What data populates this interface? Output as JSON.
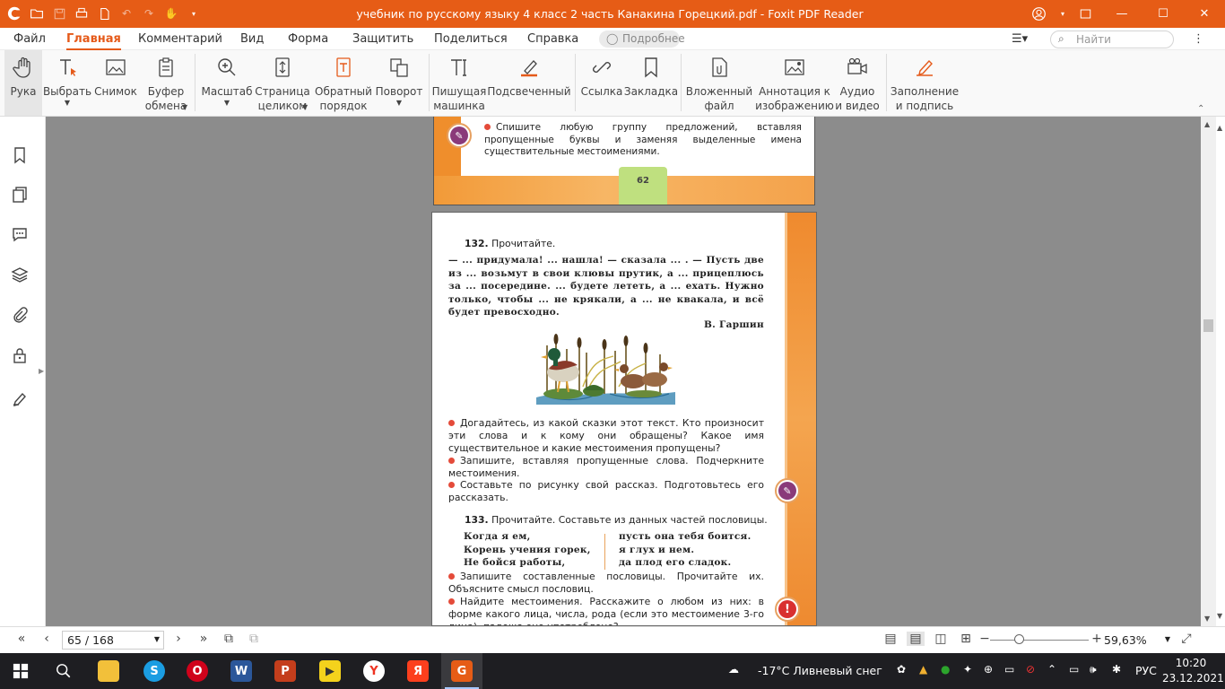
{
  "window": {
    "title": "учебник по русскому языку 4 класс 2 часть Канакина Горецкий.pdf - Foxit PDF Reader"
  },
  "menu": {
    "tabs": [
      "Файл",
      "Главная",
      "Комментарий",
      "Вид",
      "Форма",
      "Защитить",
      "Поделиться",
      "Справка"
    ],
    "active_tab": "Главная",
    "tell_me": "Подробнее",
    "search_placeholder": "Найти"
  },
  "ribbon": {
    "hand": "Рука",
    "select": "Выбрать",
    "snapshot": "Снимок",
    "clipboard_1": "Буфер",
    "clipboard_2": "обмена",
    "zoom": "Масштаб",
    "fit_1": "Страница",
    "fit_2": "целиком",
    "reverse_1": "Обратный",
    "reverse_2": "порядок",
    "rotate": "Поворот",
    "typewriter_1": "Пишущая",
    "typewriter_2": "машинка",
    "highlight": "Подсвеченный",
    "link": "Ссылка",
    "bookmark": "Закладка",
    "attach_1": "Вложенный",
    "attach_2": "файл",
    "imgannot_1": "Аннотация к",
    "imgannot_2": "изображению",
    "media_1": "Аудио",
    "media_2": "и видео",
    "fillsign_1": "Заполнение",
    "fillsign_2": "и подпись"
  },
  "doc": {
    "prev_task": "Спишите любую группу предложений, вставляя пропущенные буквы и заменяя выделенные имена существительные местоимениями.",
    "prev_page_number": "62",
    "ex132_num": "132.",
    "ex132_title": "Прочитайте.",
    "ex132_text": "— ... придумала! ... нашла! — сказала ... . — Пусть две из ... возьмут в свои клювы прутик, а ... прицеплюсь за ... посередине. ... будете лететь, а ... ехать. Нужно только, чтобы ... не крякали, а ... не квакала, и всё будет превосходно.",
    "ex132_author": "В. Гаршин",
    "task1": "Догадайтесь, из какой сказки этот текст. Кто произносит эти слова и к кому они обращены? Какое имя существительное и какие местоимения пропущены?",
    "task2": "Запишите, вставляя пропущенные слова. Подчеркните местоимения.",
    "task3": "Составьте по рисунку свой рассказ. Подготовьтесь его рассказать.",
    "ex133_num": "133.",
    "ex133_title": "Прочитайте. Составьте из данных частей пословицы.",
    "proverbs_left": [
      "Когда я ем,",
      "Корень учения горек,",
      "Не бойся работы,"
    ],
    "proverbs_right": [
      "пусть она тебя боится.",
      "я глух и нем.",
      "да плод его сладок."
    ],
    "task4": "Запишите составленные пословицы. Прочитайте их. Объясните смысл пословиц.",
    "task5": "Найдите местоимения. Расскажите о любом из них: в форме какого лица, числа, рода (если это местоимение 3-го лица), падежа оно употреблено?"
  },
  "status": {
    "page": "65 / 168",
    "zoom": "59,63%"
  },
  "taskbar": {
    "weather": "-17°C  Ливневый снег",
    "lang": "РУС",
    "time": "10:20",
    "date": "23.12.2021"
  }
}
